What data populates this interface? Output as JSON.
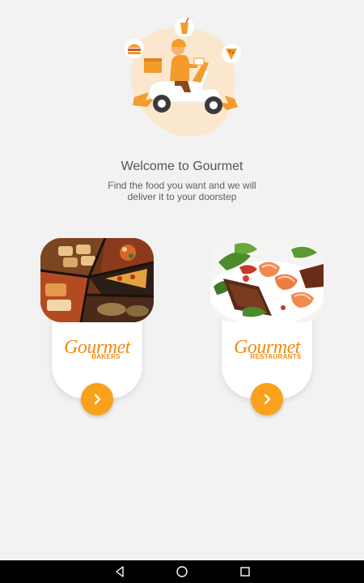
{
  "welcome": {
    "title": "Welcome to Gourmet",
    "subtitle_line1": "Find the food you want and we will",
    "subtitle_line2": "deliver it to your doorstep"
  },
  "cards": [
    {
      "brand_script": "Gourmet",
      "brand_sub": "BAKERS",
      "photo": "bakery-food-collage",
      "button_icon": "chevron-right-icon"
    },
    {
      "brand_script": "Gourmet",
      "brand_sub": "RESTAURANTS",
      "photo": "grilled-shrimp-plate",
      "button_icon": "chevron-right-icon"
    }
  ],
  "colors": {
    "accent": "#f9a11b",
    "brand": "#f28a12",
    "background": "#f2f2f2",
    "navbar": "#000000"
  },
  "navbar": {
    "icons": [
      "back-icon",
      "home-icon",
      "recents-icon"
    ]
  }
}
